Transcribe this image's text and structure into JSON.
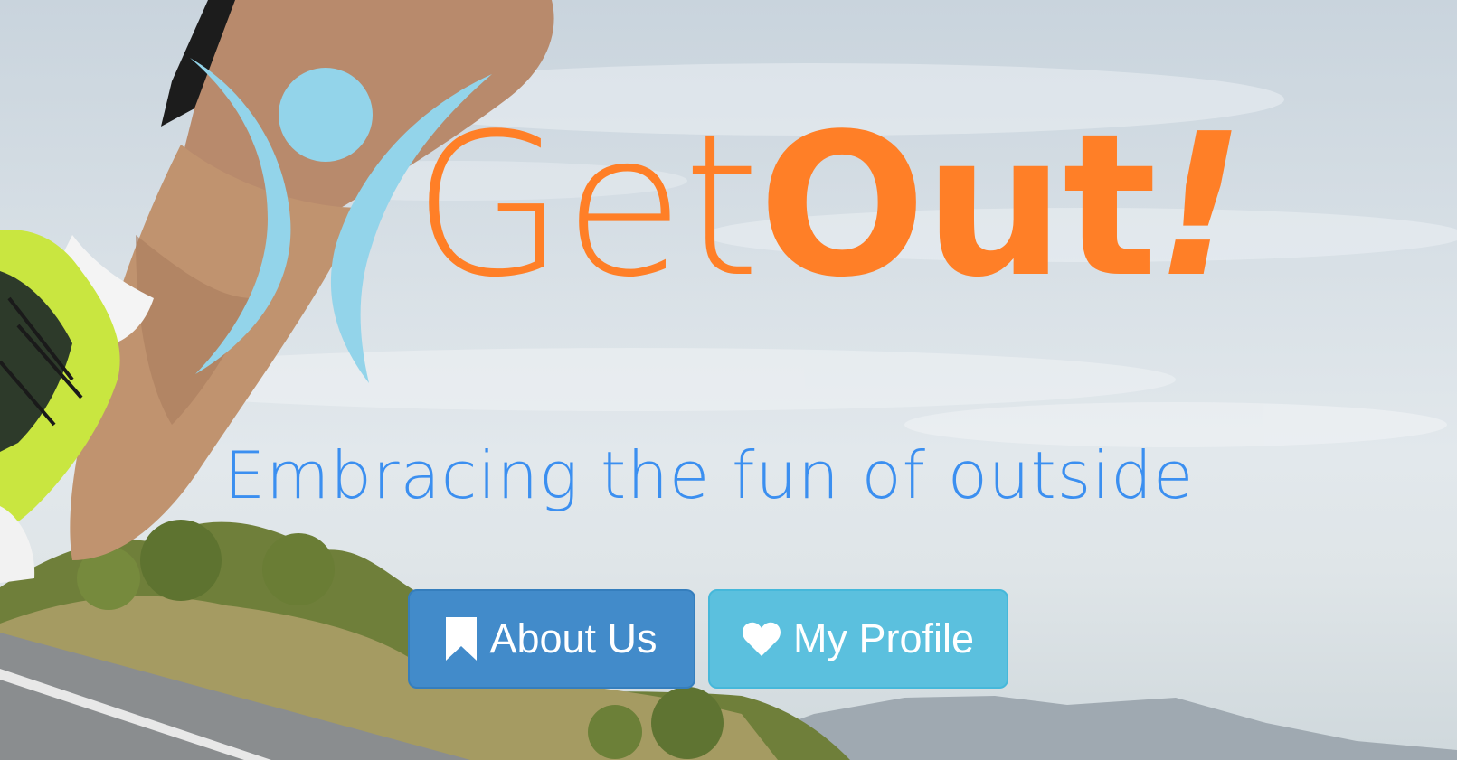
{
  "logo": {
    "word_light": "Get",
    "word_bold": "Out",
    "word_bang": "!"
  },
  "tagline": "Embracing the fun of outside",
  "buttons": {
    "about": {
      "label": "About Us",
      "icon": "bookmark-icon"
    },
    "profile": {
      "label": "My Profile",
      "icon": "heart-icon"
    }
  },
  "colors": {
    "brand_orange": "#ff7f27",
    "figure_blue": "#93d4ea",
    "tagline_blue": "#3b8ff0",
    "about_button": "#428bca",
    "profile_button": "#5bc0de"
  }
}
